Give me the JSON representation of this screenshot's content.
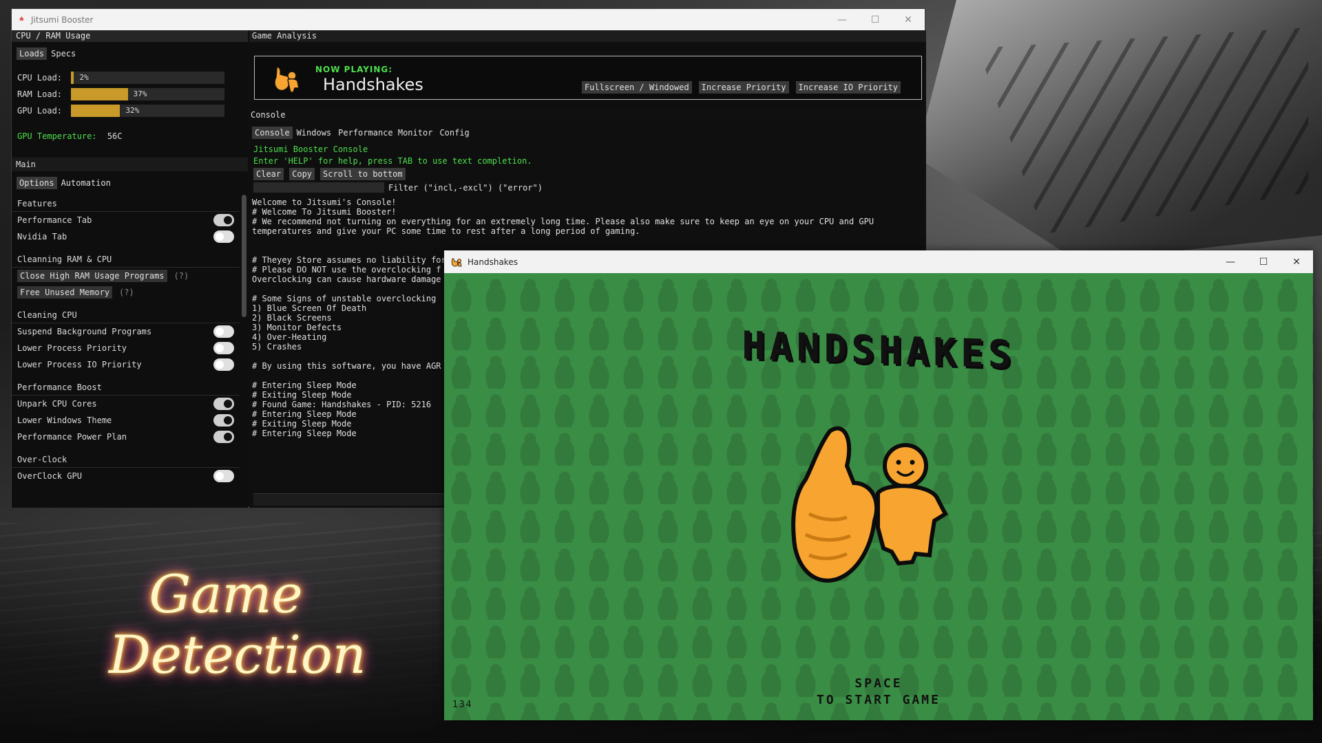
{
  "booster": {
    "title": "Jitsumi Booster",
    "left": {
      "usage_header": "CPU / RAM Usage",
      "tabs": [
        {
          "label": "Loads",
          "active": true
        },
        {
          "label": "Specs",
          "active": false
        }
      ],
      "loads": [
        {
          "label": "CPU Load:",
          "percent": 2,
          "text": "2%"
        },
        {
          "label": "RAM Load:",
          "percent": 37,
          "text": "37%"
        },
        {
          "label": "GPU Load:",
          "percent": 32,
          "text": "32%"
        }
      ],
      "gpu_temp_label": "GPU Temperature:",
      "gpu_temp_value": "56C",
      "main_header": "Main",
      "main_tabs": [
        {
          "label": "Options",
          "active": true
        },
        {
          "label": "Automation",
          "active": false
        }
      ],
      "groups": {
        "features": {
          "title": "Features",
          "items": [
            {
              "label": "Performance Tab",
              "on": true
            },
            {
              "label": "Nvidia Tab",
              "on": false
            }
          ]
        },
        "cleaning_ram": {
          "title": "Cleanning RAM & CPU",
          "buttons": [
            {
              "label": "Close High RAM Usage Programs",
              "help": "(?)"
            },
            {
              "label": "Free Unused Memory",
              "help": "(?)"
            }
          ]
        },
        "cleaning_cpu": {
          "title": "Cleaning CPU",
          "items": [
            {
              "label": "Suspend Background Programs",
              "on": false
            },
            {
              "label": "Lower Process Priority",
              "on": false
            },
            {
              "label": "Lower Process IO Priority",
              "on": false
            }
          ]
        },
        "perf_boost": {
          "title": "Performance Boost",
          "items": [
            {
              "label": "Unpark CPU Cores",
              "on": true
            },
            {
              "label": "Lower Windows Theme",
              "on": true
            },
            {
              "label": "Performance Power Plan",
              "on": true
            }
          ]
        },
        "overclock": {
          "title": "Over-Clock",
          "items": [
            {
              "label": "OverClock GPU",
              "on": false
            }
          ]
        }
      }
    },
    "right": {
      "ga_header": "Game Analysis",
      "now_playing_label": "NOW PLAYING:",
      "now_playing_title": "Handshakes",
      "np_buttons": [
        "Fullscreen / Windowed",
        "Increase Priority",
        "Increase IO Priority"
      ],
      "console_header": "Console",
      "console_tabs": [
        {
          "label": "Console",
          "active": true
        },
        {
          "label": "Windows",
          "active": false
        },
        {
          "label": "Performance Monitor",
          "active": false
        },
        {
          "label": "Config",
          "active": false
        }
      ],
      "console_intro": [
        "Jitsumi Booster Console",
        "Enter 'HELP' for help, press TAB to use text completion."
      ],
      "console_actions": [
        "Clear",
        "Copy",
        "Scroll to bottom"
      ],
      "filter_label": "Filter (\"incl,-excl\") (\"error\")",
      "log_lines": [
        "Welcome to Jitsumi's Console!",
        "# Welcome To Jitsumi Booster!",
        "# We recommend not turning on everything for an extremely long time. Please also make sure to keep an eye on your CPU and GPU",
        "temperatures and give your PC some time to rest after a long period of gaming.",
        "",
        "",
        "# Theyey Store assumes no liability for",
        "# Please DO NOT use the overclocking f",
        "Overclocking can cause hardware damage",
        "",
        "# Some Signs of unstable overclocking",
        "1) Blue Screen Of Death",
        "2) Black Screens",
        "3) Monitor Defects",
        "4) Over-Heating",
        "5) Crashes",
        "",
        "# By using this software, you have AGR",
        "",
        "# Entering Sleep Mode",
        "# Exiting Sleep Mode",
        "# Found Game: Handshakes - PID: 5216",
        "# Entering Sleep Mode",
        "# Exiting Sleep Mode",
        "# Entering Sleep Mode"
      ]
    }
  },
  "game": {
    "title": "Handshakes",
    "logo_text": "HANDSHAKES",
    "prompt_line1": "SPACE",
    "prompt_line2": "TO START GAME",
    "counter": "134"
  },
  "promo": {
    "line1": "Game",
    "line2": "Detection"
  },
  "colors": {
    "accent_green": "#4de04d",
    "bar_gold": "#c99a2a",
    "game_green": "#3a8d45",
    "mascot_orange": "#f7a431"
  }
}
